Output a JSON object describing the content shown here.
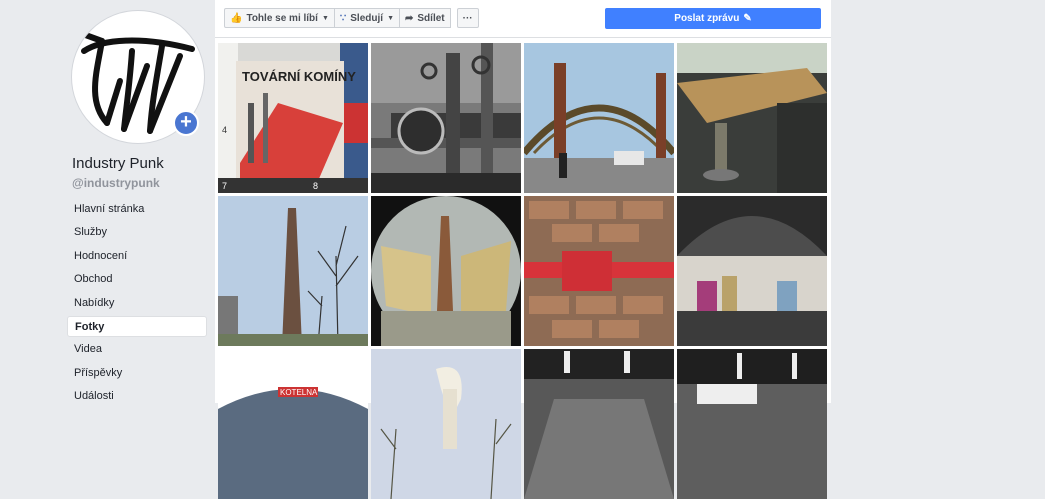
{
  "page": {
    "name": "Industry Punk",
    "handle": "@industrypunk"
  },
  "nav": [
    {
      "label": "Hlavní stránka",
      "active": false
    },
    {
      "label": "Služby",
      "active": false
    },
    {
      "label": "Hodnocení",
      "active": false
    },
    {
      "label": "Obchod",
      "active": false
    },
    {
      "label": "Nabídky",
      "active": false
    },
    {
      "label": "Fotky",
      "active": true
    },
    {
      "label": "Videa",
      "active": false
    },
    {
      "label": "Příspěvky",
      "active": false
    },
    {
      "label": "Události",
      "active": false
    }
  ],
  "actions": {
    "like": "Tohle se mi líbí",
    "follow": "Sledují",
    "share": "Sdílet",
    "more": "···",
    "send_message": "Poslat zprávu"
  },
  "photos": [
    {
      "name": "photo-tovarni-kominy-book",
      "overlay_text": "TOVÁRNÍ KOMÍNY"
    },
    {
      "name": "photo-pipes-valves"
    },
    {
      "name": "photo-bridge-street"
    },
    {
      "name": "photo-interior-table"
    },
    {
      "name": "photo-chimney-trees"
    },
    {
      "name": "photo-fisheye-chimney"
    },
    {
      "name": "photo-brick-wall-red-hinge"
    },
    {
      "name": "photo-exhibition-hall"
    },
    {
      "name": "photo-building-sign",
      "overlay_text": "KOTELNA"
    },
    {
      "name": "photo-sculpture-trees"
    },
    {
      "name": "photo-factory-interior-1"
    },
    {
      "name": "photo-factory-interior-2"
    }
  ],
  "colors": {
    "background": "#e9ebee",
    "accent": "#4080ff",
    "link": "#4267b2"
  }
}
